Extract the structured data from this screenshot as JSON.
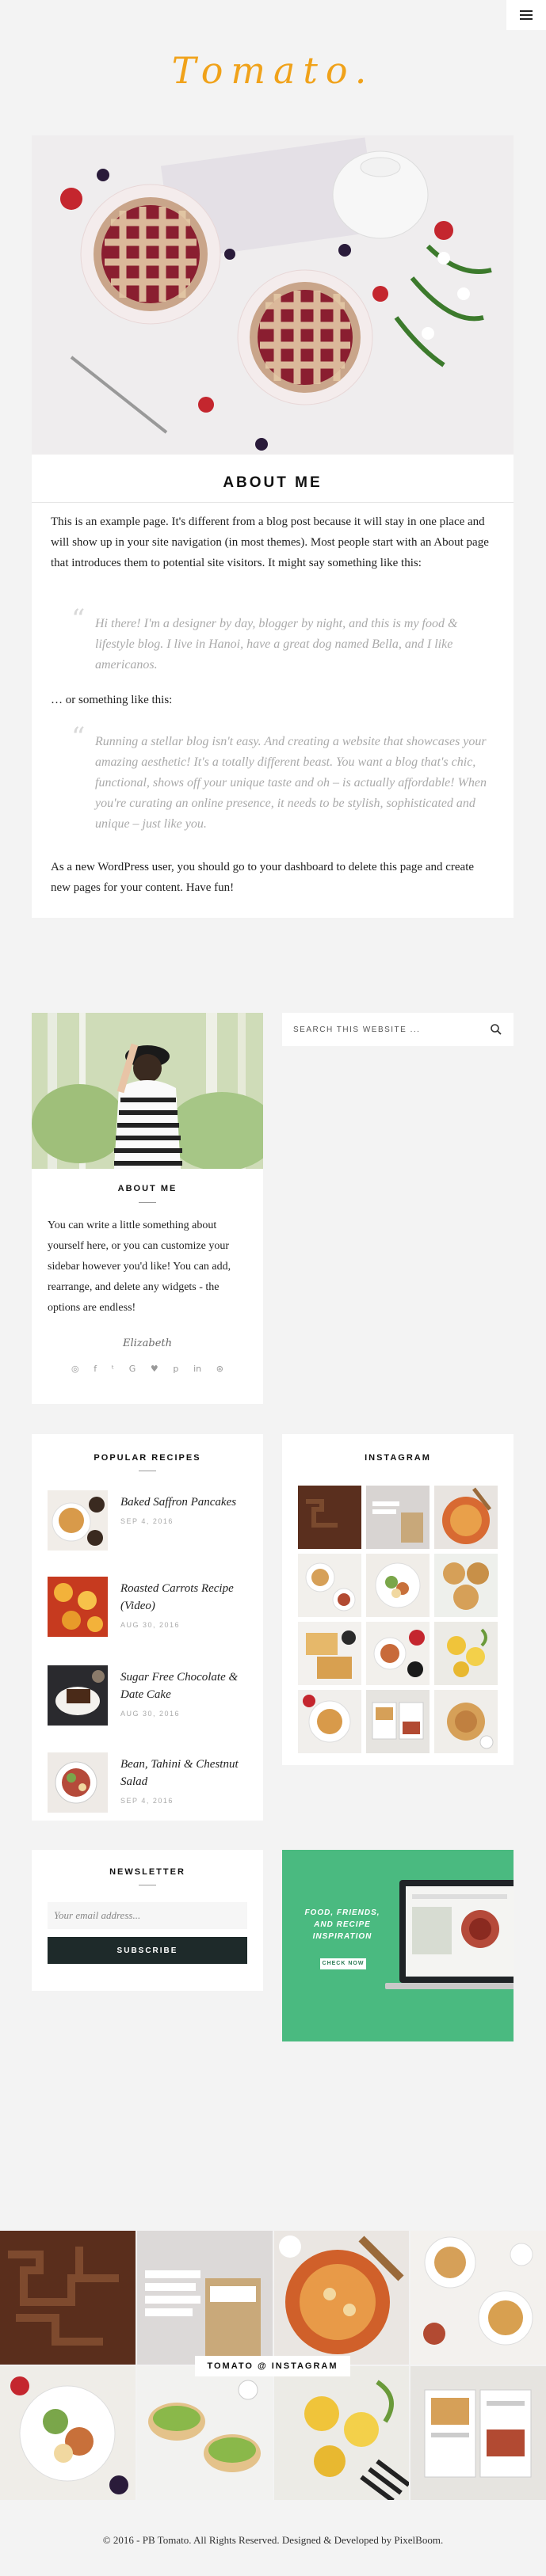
{
  "site": {
    "logo": "Tomato.",
    "menu_icon": "hamburger-icon",
    "accent_color": "#f0a21a"
  },
  "about_page": {
    "title": "ABOUT ME",
    "intro": "This is an example page. It's different from a blog post because it will stay in one place and will show up in your site navigation (in most themes). Most people start with an About page that introduces them to potential site visitors. It might say something like this:",
    "quote1": "Hi there! I'm a designer by day, blogger by night, and this is my food & lifestyle blog. I live in Hanoi, have a great dog named Bella, and I like americanos.",
    "middle": "… or something like this:",
    "quote2": "Running a stellar blog isn't easy. And creating a website that showcases your amazing aesthetic! It's a totally different beast. You want a blog that's chic, functional, shows off your unique taste and oh – is actually affordable! When you're curating an online presence, it needs to be stylish, sophisticated and unique – just like you.",
    "outro": "As a new WordPress user, you should go to your dashboard to delete this page and create new pages for your content. Have fun!"
  },
  "about_widget": {
    "title": "ABOUT ME",
    "text": "You can write a little something about yourself here, or you can customize your sidebar however you'd like! You can add, rearrange, and delete any widgets - the options are endless!",
    "signature": "Elizabeth",
    "social_icons": [
      "instagram-icon",
      "facebook-icon",
      "twitter-icon",
      "google-plus-icon",
      "bloglovin-icon",
      "pinterest-icon",
      "linkedin-icon",
      "dribbble-icon"
    ]
  },
  "search": {
    "placeholder": "SEARCH THIS WEBSITE ..."
  },
  "popular_recipes": {
    "title": "POPULAR RECIPES",
    "items": [
      {
        "title": "Baked Saffron Pancakes",
        "date": "SEP 4, 2016"
      },
      {
        "title": "Roasted Carrots Recipe (Video)",
        "date": "AUG 30, 2016"
      },
      {
        "title": "Sugar Free Chocolate & Date Cake",
        "date": "AUG 30, 2016"
      },
      {
        "title": "Bean, Tahini & Chestnut Salad",
        "date": "SEP 4, 2016"
      }
    ]
  },
  "instagram_widget": {
    "title": "INSTAGRAM"
  },
  "newsletter": {
    "title": "NEWSLETTER",
    "placeholder": "Your email address...",
    "button": "SUBSCRIBE"
  },
  "ad": {
    "headline": "FOOD, FRIENDS, AND RECIPE INSPIRATION",
    "button": "CHECK NOW",
    "bg_color": "#4aba80"
  },
  "footer": {
    "instagram_label": "TOMATO @ INSTAGRAM",
    "copyright": "© 2016 - PB Tomato. All Rights Reserved. Designed & Developed by PixelBoom."
  }
}
